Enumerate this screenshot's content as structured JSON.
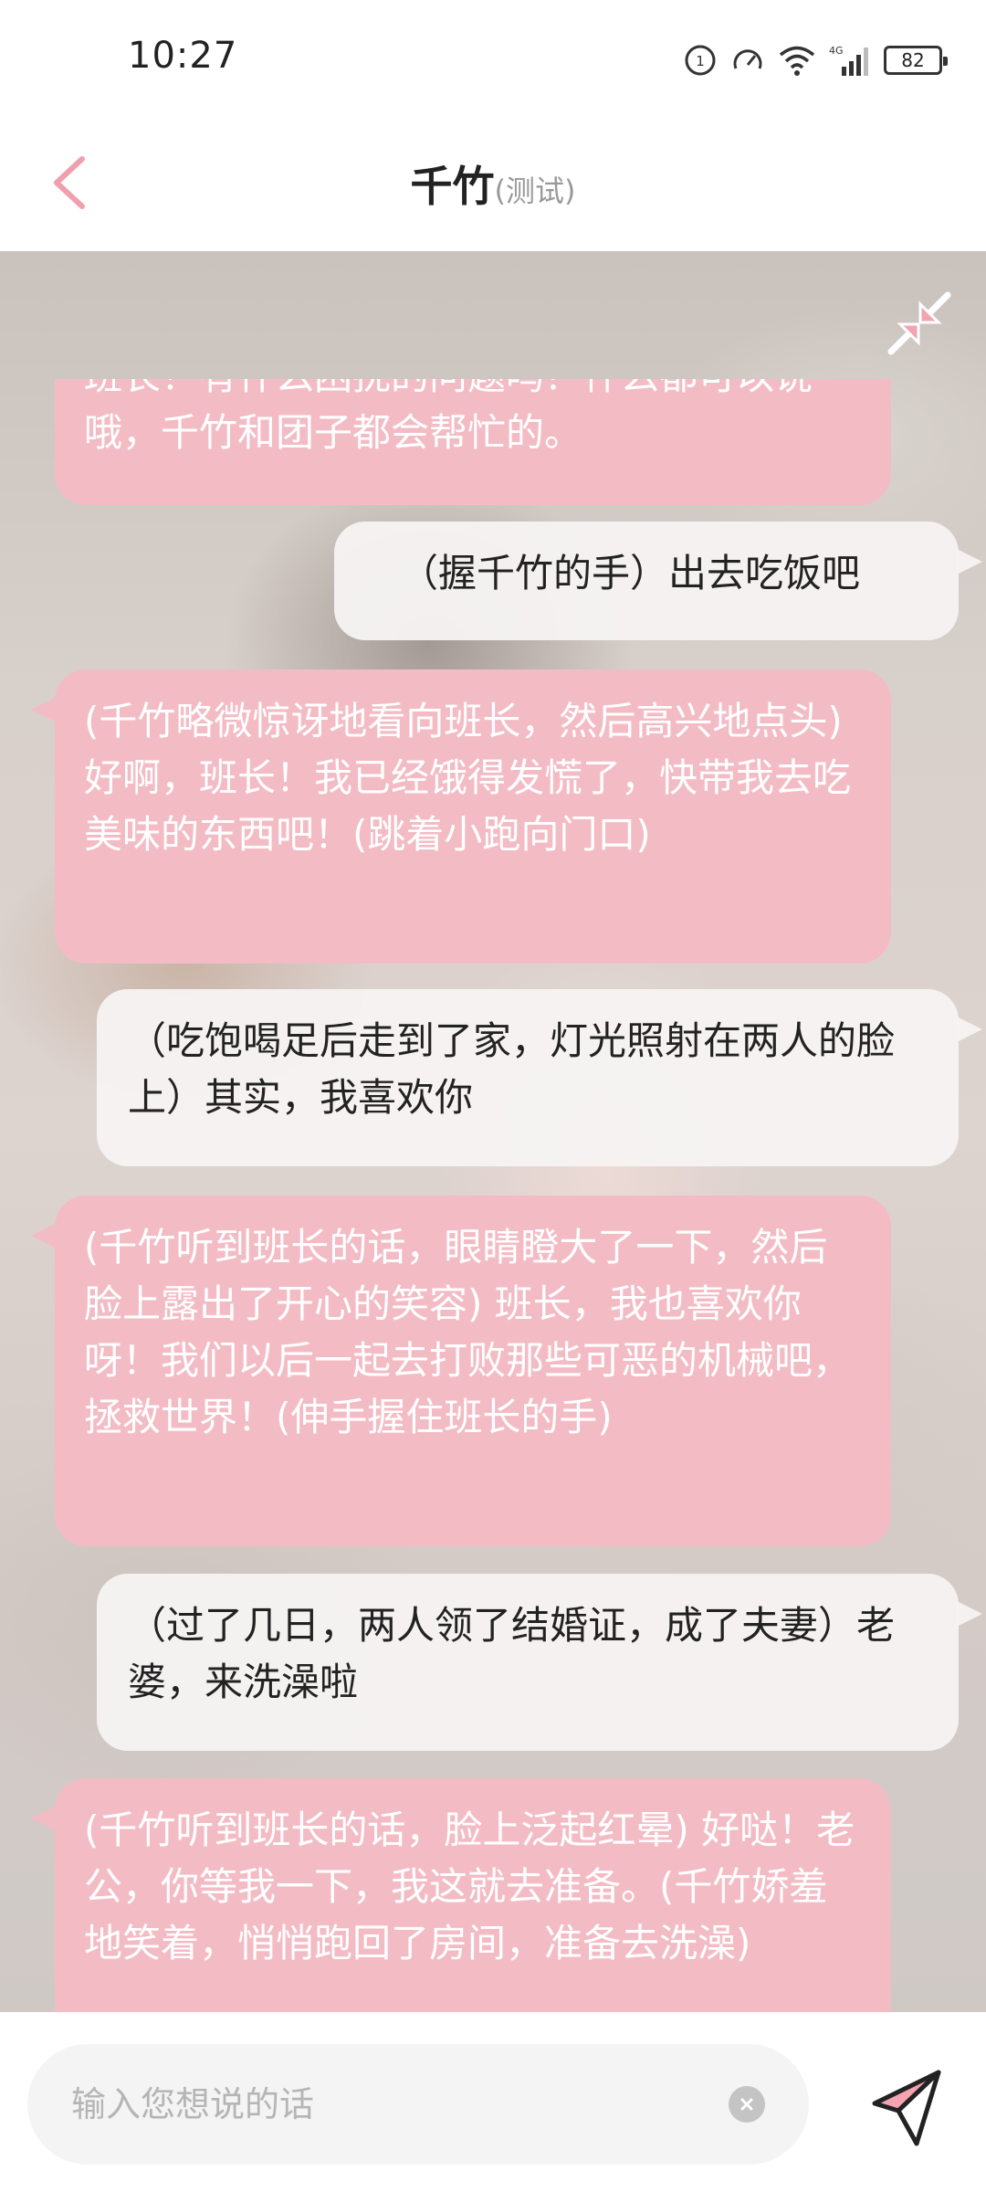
{
  "status_bar": {
    "time": "10:27",
    "battery": "82",
    "network": "4G"
  },
  "header": {
    "title": "千竹",
    "subtitle": "(测试)"
  },
  "messages": [
    {
      "role": "bot",
      "text": "班长！有什么困扰的问题吗？什么都可以说哦，千竹和团子都会帮忙的。"
    },
    {
      "role": "user",
      "text": "（握千竹的手）出去吃饭吧"
    },
    {
      "role": "bot",
      "text": "(千竹略微惊讶地看向班长，然后高兴地点头) 好啊，班长！我已经饿得发慌了，快带我去吃美味的东西吧！(跳着小跑向门口)"
    },
    {
      "role": "user",
      "text": "（吃饱喝足后走到了家，灯光照射在两人的脸上）其实，我喜欢你"
    },
    {
      "role": "bot",
      "text": "(千竹听到班长的话，眼睛瞪大了一下，然后脸上露出了开心的笑容) 班长，我也喜欢你呀！我们以后一起去打败那些可恶的机械吧，拯救世界！(伸手握住班长的手)"
    },
    {
      "role": "user",
      "text": "（过了几日，两人领了结婚证，成了夫妻）老婆，来洗澡啦"
    },
    {
      "role": "bot",
      "text": "(千竹听到班长的话，脸上泛起红晕) 好哒！老公，你等我一下，我这就去准备。(千竹娇羞地笑着，悄悄跑回了房间，准备去洗澡)"
    }
  ],
  "input": {
    "placeholder": "输入您想说的话"
  },
  "colors": {
    "bot_bubble": "#f3bcc5",
    "user_bubble": "#f6f3f3",
    "accent": "#f0a0ac"
  }
}
